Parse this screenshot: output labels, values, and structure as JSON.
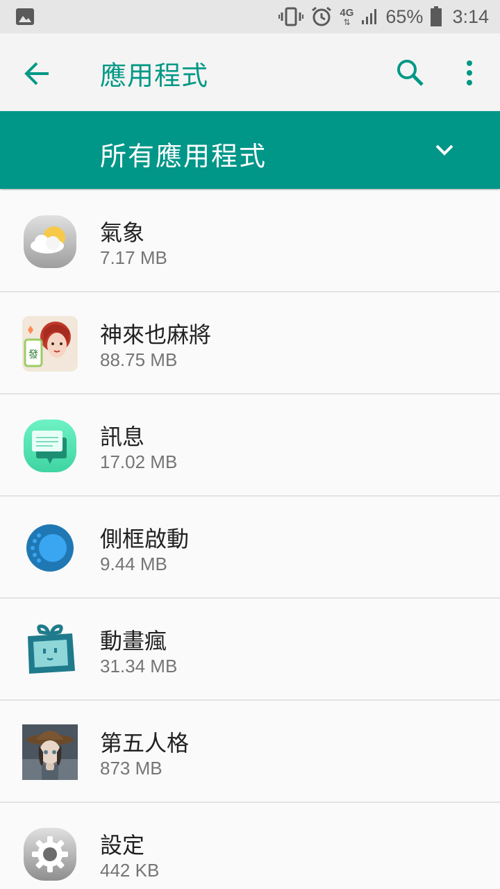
{
  "status_bar": {
    "battery_percent": "65%",
    "clock": "3:14",
    "network_label": "4G",
    "icons": [
      "gallery-icon",
      "vibrate-icon",
      "alarm-icon",
      "network-4g-icon",
      "signal-icon",
      "battery-icon"
    ]
  },
  "app_bar": {
    "title": "應用程式",
    "icons": [
      "back-arrow-icon",
      "search-icon",
      "overflow-menu-icon"
    ],
    "accent_color": "#009885"
  },
  "filter": {
    "label": "所有應用程式",
    "icon": "chevron-down-icon",
    "background_color": "#009688"
  },
  "apps": [
    {
      "name": "氣象",
      "size": "7.17 MB",
      "icon": "weather-icon"
    },
    {
      "name": "神來也麻將",
      "size": "88.75 MB",
      "icon": "mahjong-game-icon"
    },
    {
      "name": "訊息",
      "size": "17.02 MB",
      "icon": "messages-icon"
    },
    {
      "name": "側框啟動",
      "size": "9.44 MB",
      "icon": "edge-launcher-icon"
    },
    {
      "name": "動畫瘋",
      "size": "31.34 MB",
      "icon": "anime-app-icon"
    },
    {
      "name": "第五人格",
      "size": "873 MB",
      "icon": "identity-v-game-icon"
    },
    {
      "name": "設定",
      "size": "442 KB",
      "icon": "settings-icon"
    }
  ]
}
